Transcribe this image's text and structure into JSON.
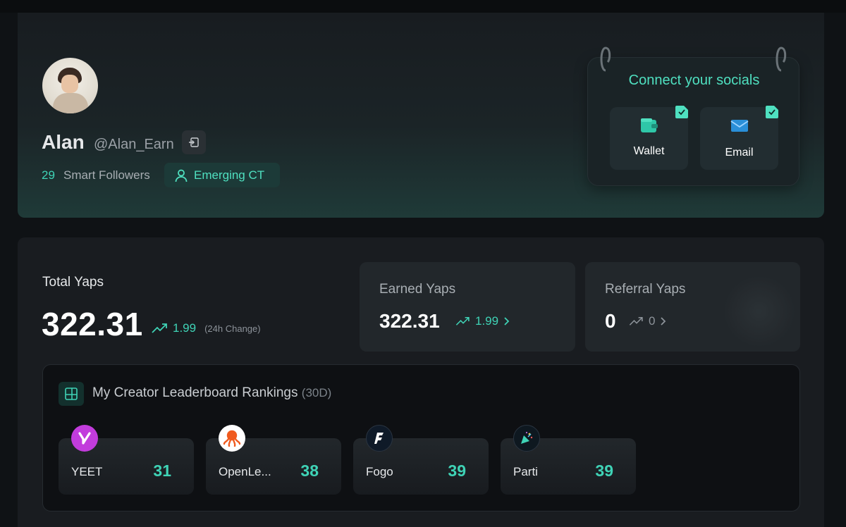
{
  "profile": {
    "name": "Alan",
    "handle": "@Alan_Earn",
    "smart_followers_count": "29",
    "smart_followers_label": "Smart Followers",
    "tier_label": "Emerging CT"
  },
  "socials": {
    "title": "Connect your socials",
    "items": [
      {
        "label": "Wallet",
        "icon": "wallet-icon",
        "connected": true
      },
      {
        "label": "Email",
        "icon": "mail-icon",
        "connected": true
      }
    ]
  },
  "yaps": {
    "total_label": "Total Yaps",
    "total_value": "322.31",
    "total_change": "1.99",
    "total_change_note": "(24h Change)",
    "earned_label": "Earned Yaps",
    "earned_value": "322.31",
    "earned_change": "1.99",
    "referral_label": "Referral Yaps",
    "referral_value": "0",
    "referral_change": "0"
  },
  "leaderboard": {
    "title": "My Creator Leaderboard Rankings",
    "period": "(30D)",
    "items": [
      {
        "name": "YEET",
        "rank": "31",
        "logo": "yeet-logo",
        "color": "#c23cdc"
      },
      {
        "name": "OpenLe...",
        "rank": "38",
        "logo": "octopus-logo",
        "color": "#f05a1e"
      },
      {
        "name": "Fogo",
        "rank": "39",
        "logo": "fogo-logo",
        "color": "#0f1a28"
      },
      {
        "name": "Parti",
        "rank": "39",
        "logo": "party-popper-logo",
        "color": "#0e1820"
      }
    ]
  },
  "colors": {
    "accent": "#3fd3b6",
    "background": "#0f1215",
    "card": "#191c20"
  }
}
